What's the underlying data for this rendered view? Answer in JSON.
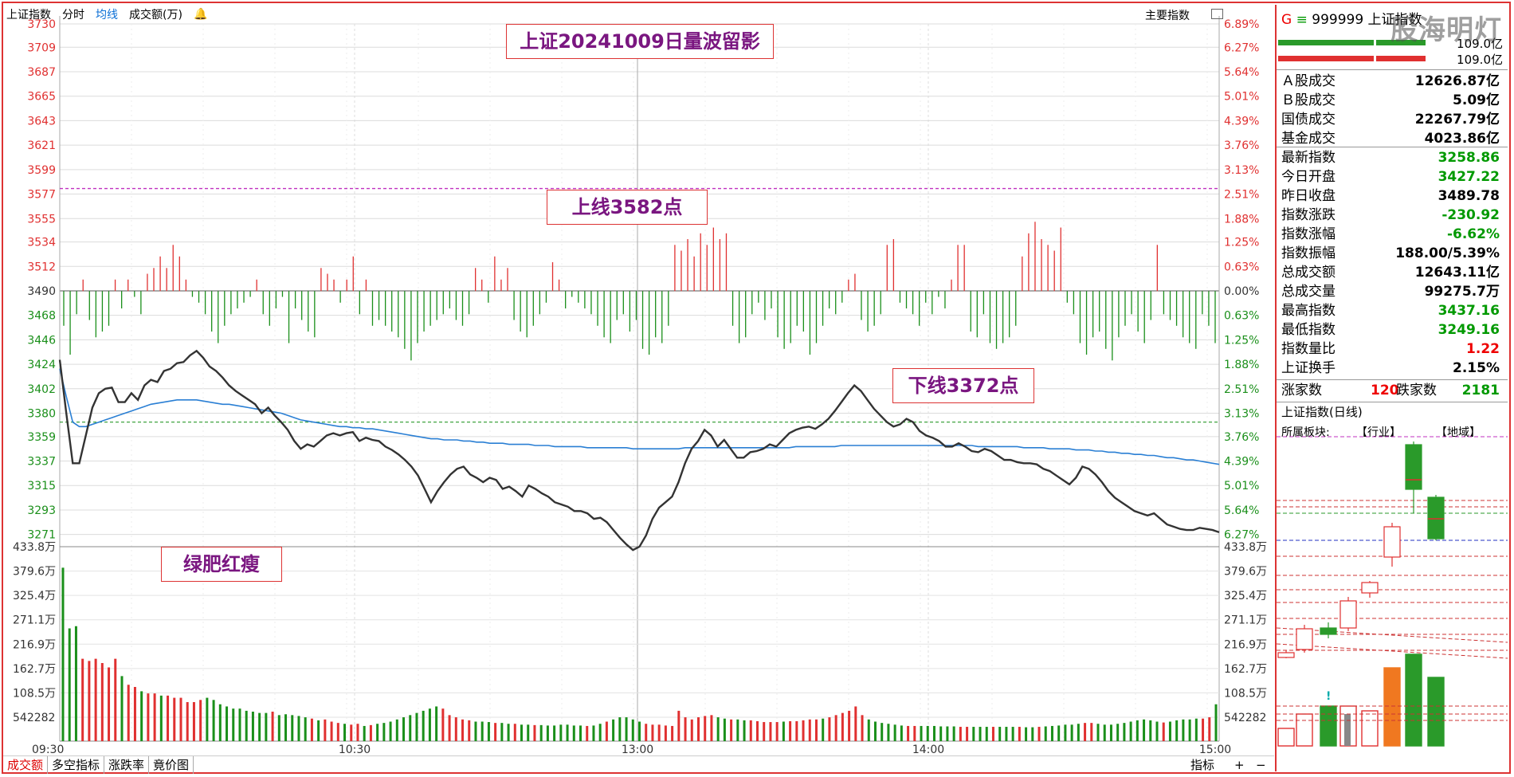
{
  "header": {
    "index_name": "上证指数",
    "tabs": [
      "分时",
      "均线",
      "成交额(万)"
    ],
    "main_indicator": "主要指数"
  },
  "annotations": {
    "title": "上证20241009日量波留影",
    "upper_line": "上线3582点",
    "lower_line": "下线3372点",
    "volume_note": "绿肥红瘦"
  },
  "price_axis": {
    "left_ticks": [
      "3730",
      "3709",
      "3687",
      "3665",
      "3643",
      "3621",
      "3599",
      "3577",
      "3555",
      "3534",
      "3512",
      "3490",
      "3468",
      "3446",
      "3424",
      "3402",
      "3380",
      "3359",
      "3337",
      "3315",
      "3293",
      "3271"
    ],
    "right_ticks": [
      "6.89%",
      "6.27%",
      "5.64%",
      "5.01%",
      "4.39%",
      "3.76%",
      "3.13%",
      "2.51%",
      "1.88%",
      "1.25%",
      "0.63%",
      "0.00%",
      "0.63%",
      "1.25%",
      "1.88%",
      "2.51%",
      "3.13%",
      "3.76%",
      "4.39%",
      "5.01%",
      "5.64%",
      "6.27%"
    ],
    "upper_red_ticks": 11
  },
  "volume_axis": {
    "ticks": [
      "433.8万",
      "379.6万",
      "325.4万",
      "271.1万",
      "216.9万",
      "162.7万",
      "108.5万",
      "542282"
    ]
  },
  "time_axis": [
    "09:30",
    "10:30",
    "13:00",
    "14:00",
    "15:00"
  ],
  "chart_data": {
    "type": "line",
    "title": "",
    "prev_close": 3489.78,
    "ylim": [
      3260,
      3730
    ],
    "upper_line_value": 3582,
    "lower_line_value": 3372,
    "price": [
      3428,
      3380,
      3335,
      3335,
      3360,
      3385,
      3398,
      3402,
      3403,
      3390,
      3390,
      3398,
      3392,
      3405,
      3410,
      3408,
      3418,
      3420,
      3425,
      3426,
      3432,
      3436,
      3430,
      3422,
      3418,
      3412,
      3405,
      3400,
      3396,
      3392,
      3388,
      3380,
      3385,
      3378,
      3372,
      3365,
      3355,
      3348,
      3352,
      3350,
      3355,
      3360,
      3362,
      3360,
      3362,
      3363,
      3355,
      3358,
      3356,
      3355,
      3350,
      3347,
      3343,
      3338,
      3332,
      3324,
      3312,
      3300,
      3310,
      3318,
      3325,
      3330,
      3332,
      3325,
      3322,
      3318,
      3322,
      3320,
      3312,
      3314,
      3310,
      3305,
      3315,
      3312,
      3308,
      3305,
      3300,
      3298,
      3296,
      3292,
      3292,
      3290,
      3285,
      3286,
      3282,
      3275,
      3268,
      3262,
      3257,
      3260,
      3270,
      3285,
      3295,
      3300,
      3305,
      3318,
      3335,
      3348,
      3355,
      3365,
      3360,
      3350,
      3356,
      3348,
      3340,
      3340,
      3345,
      3346,
      3348,
      3352,
      3350,
      3356,
      3362,
      3365,
      3367,
      3368,
      3366,
      3370,
      3375,
      3382,
      3390,
      3398,
      3405,
      3400,
      3392,
      3384,
      3378,
      3372,
      3368,
      3370,
      3375,
      3372,
      3364,
      3360,
      3358,
      3355,
      3350,
      3350,
      3353,
      3350,
      3346,
      3345,
      3348,
      3346,
      3342,
      3338,
      3338,
      3336,
      3335,
      3335,
      3334,
      3330,
      3328,
      3324,
      3320,
      3316,
      3322,
      3332,
      3330,
      3325,
      3318,
      3310,
      3304,
      3300,
      3296,
      3292,
      3290,
      3288,
      3290,
      3285,
      3280,
      3278,
      3276,
      3275,
      3275,
      3277,
      3276,
      3275,
      3273
    ],
    "avg": [
      3420,
      3395,
      3372,
      3368,
      3368,
      3370,
      3372,
      3374,
      3376,
      3378,
      3380,
      3382,
      3384,
      3386,
      3388,
      3389,
      3390,
      3391,
      3392,
      3392,
      3392,
      3392,
      3391,
      3390,
      3389,
      3388,
      3388,
      3387,
      3386,
      3385,
      3384,
      3383,
      3382,
      3381,
      3380,
      3378,
      3376,
      3374,
      3373,
      3372,
      3371,
      3370,
      3369,
      3368,
      3368,
      3367,
      3367,
      3366,
      3366,
      3365,
      3364,
      3363,
      3362,
      3361,
      3360,
      3359,
      3358,
      3357,
      3357,
      3356,
      3356,
      3356,
      3355,
      3355,
      3354,
      3354,
      3353,
      3353,
      3353,
      3352,
      3352,
      3352,
      3352,
      3351,
      3351,
      3351,
      3350,
      3350,
      3350,
      3350,
      3350,
      3349,
      3349,
      3349,
      3349,
      3349,
      3349,
      3349,
      3348,
      3348,
      3348,
      3348,
      3348,
      3348,
      3348,
      3348,
      3349,
      3349,
      3349,
      3349,
      3349,
      3349,
      3349,
      3349,
      3349,
      3349,
      3349,
      3349,
      3349,
      3349,
      3349,
      3349,
      3349,
      3350,
      3350,
      3350,
      3350,
      3350,
      3350,
      3350,
      3351,
      3351,
      3351,
      3351,
      3351,
      3351,
      3351,
      3351,
      3351,
      3351,
      3351,
      3351,
      3351,
      3351,
      3351,
      3351,
      3351,
      3351,
      3351,
      3351,
      3351,
      3350,
      3350,
      3350,
      3350,
      3350,
      3350,
      3350,
      3349,
      3349,
      3349,
      3349,
      3348,
      3348,
      3348,
      3348,
      3347,
      3347,
      3347,
      3346,
      3346,
      3345,
      3345,
      3344,
      3344,
      3343,
      3343,
      3342,
      3342,
      3341,
      3340,
      3340,
      3339,
      3338,
      3338,
      3337,
      3336,
      3335,
      3334
    ],
    "breadth_ticks": [
      -30,
      -55,
      -20,
      10,
      -25,
      -40,
      -35,
      -30,
      10,
      -15,
      10,
      -5,
      -20,
      15,
      20,
      30,
      20,
      40,
      30,
      10,
      -5,
      -10,
      -20,
      -35,
      -45,
      -30,
      -20,
      -15,
      -10,
      -5,
      10,
      -20,
      -30,
      -15,
      -5,
      -45,
      -15,
      -25,
      -35,
      -40,
      20,
      15,
      10,
      -10,
      10,
      30,
      -20,
      10,
      -30,
      -25,
      -30,
      -35,
      -40,
      -50,
      -60,
      -45,
      -35,
      -30,
      -25,
      -20,
      -15,
      -25,
      -30,
      -20,
      20,
      10,
      -10,
      30,
      10,
      20,
      -25,
      -35,
      -40,
      -30,
      -20,
      -10,
      25,
      10,
      -15,
      -5,
      -10,
      -15,
      -20,
      -30,
      -40,
      -45,
      -25,
      -20,
      -35,
      -25,
      -50,
      -55,
      -40,
      -45,
      -30,
      40,
      35,
      45,
      30,
      50,
      40,
      55,
      45,
      50,
      -30,
      -45,
      -40,
      -20,
      -10,
      -25,
      -15,
      -40,
      -50,
      -45,
      -30,
      -35,
      -55,
      -45,
      -30,
      -15,
      -20,
      -10,
      10,
      15,
      -25,
      -35,
      -30,
      -20,
      40,
      45,
      -10,
      -15,
      -20,
      -30,
      -10,
      -20,
      -5,
      -15,
      10,
      40,
      40,
      -35,
      -40,
      -20,
      -45,
      -50,
      -45,
      -40,
      -30,
      30,
      50,
      60,
      45,
      40,
      35,
      55,
      -10,
      -20,
      -45,
      -55,
      -40,
      -35,
      -50,
      -60,
      -40,
      -30,
      -20,
      -35,
      -45,
      -25,
      40,
      -20,
      -25,
      -30,
      -40,
      -45,
      -50,
      -20,
      -30,
      -45
    ],
    "volume": [
      400,
      260,
      265,
      190,
      185,
      190,
      180,
      170,
      190,
      150,
      130,
      125,
      115,
      110,
      110,
      105,
      105,
      100,
      100,
      90,
      90,
      95,
      100,
      95,
      85,
      80,
      75,
      75,
      70,
      68,
      65,
      65,
      68,
      60,
      62,
      60,
      58,
      55,
      52,
      48,
      50,
      45,
      42,
      40,
      38,
      40,
      35,
      37,
      40,
      42,
      45,
      50,
      55,
      60,
      65,
      70,
      75,
      80,
      75,
      60,
      55,
      50,
      48,
      45,
      45,
      44,
      42,
      42,
      40,
      40,
      38,
      38,
      37,
      37,
      36,
      36,
      38,
      38,
      36,
      36,
      35,
      36,
      40,
      45,
      50,
      55,
      55,
      50,
      45,
      40,
      38,
      38,
      36,
      35,
      70,
      55,
      50,
      55,
      58,
      60,
      55,
      52,
      50,
      50,
      48,
      48,
      46,
      44,
      44,
      44,
      45,
      46,
      46,
      48,
      50,
      50,
      52,
      55,
      60,
      65,
      70,
      80,
      60,
      50,
      45,
      42,
      40,
      38,
      36,
      35,
      35,
      35,
      35,
      35,
      34,
      34,
      34,
      33,
      33,
      33,
      33,
      33,
      33,
      33,
      33,
      33,
      33,
      32,
      32,
      33,
      34,
      35,
      36,
      38,
      38,
      40,
      42,
      42,
      40,
      38,
      38,
      40,
      42,
      45,
      48,
      50,
      48,
      45,
      43,
      45,
      48,
      50,
      50,
      52,
      52,
      55,
      85
    ]
  },
  "right_panel": {
    "header": "999999 上证指数",
    "header_prefix": "G",
    "bar_values": [
      "109.0亿",
      "109.0亿"
    ],
    "rows": [
      {
        "k": "Ａ股成交",
        "v": "12626.87亿",
        "c": ""
      },
      {
        "k": "Ｂ股成交",
        "v": "5.09亿",
        "c": ""
      },
      {
        "k": "国债成交",
        "v": "22267.79亿",
        "c": ""
      },
      {
        "k": "基金成交",
        "v": "4023.86亿",
        "c": ""
      },
      {
        "k": "最新指数",
        "v": "3258.86",
        "c": "green"
      },
      {
        "k": "今日开盘",
        "v": "3427.22",
        "c": "green"
      },
      {
        "k": "昨日收盘",
        "v": "3489.78",
        "c": ""
      },
      {
        "k": "指数涨跌",
        "v": "-230.92",
        "c": "green"
      },
      {
        "k": "指数涨幅",
        "v": "-6.62%",
        "c": "green"
      },
      {
        "k": "指数振幅",
        "v": "188.00/5.39%",
        "c": ""
      },
      {
        "k": "总成交额",
        "v": "12643.11亿",
        "c": ""
      },
      {
        "k": "总成交量",
        "v": "99275.7万",
        "c": ""
      },
      {
        "k": "最高指数",
        "v": "3437.16",
        "c": "green"
      },
      {
        "k": "最低指数",
        "v": "3249.16",
        "c": "green"
      },
      {
        "k": "指数量比",
        "v": "1.22",
        "c": "red"
      },
      {
        "k": "上证换手",
        "v": "2.15%",
        "c": ""
      }
    ],
    "up_label": "涨家数",
    "up_value": "120",
    "down_label": "跌家数",
    "down_value": "2181",
    "mini_title": "上证指数(日线)",
    "sector_label": "所属板块:",
    "industry_label": "【行业】",
    "region_label": "【地域】",
    "watermark": "股海明灯"
  },
  "bottom_tabs": [
    "成交额",
    "多空指标",
    "涨跌率",
    "竟价图"
  ],
  "bottom_right": {
    "indicator": "指标",
    "plus": "+",
    "minus": "−"
  },
  "colors": {
    "up": "#e03030",
    "down": "#1a8f1a",
    "price_line": "#333333",
    "avg_line": "#2a7fd4",
    "upper_line": "#c030c0",
    "lower_line": "#2a9a2a"
  }
}
